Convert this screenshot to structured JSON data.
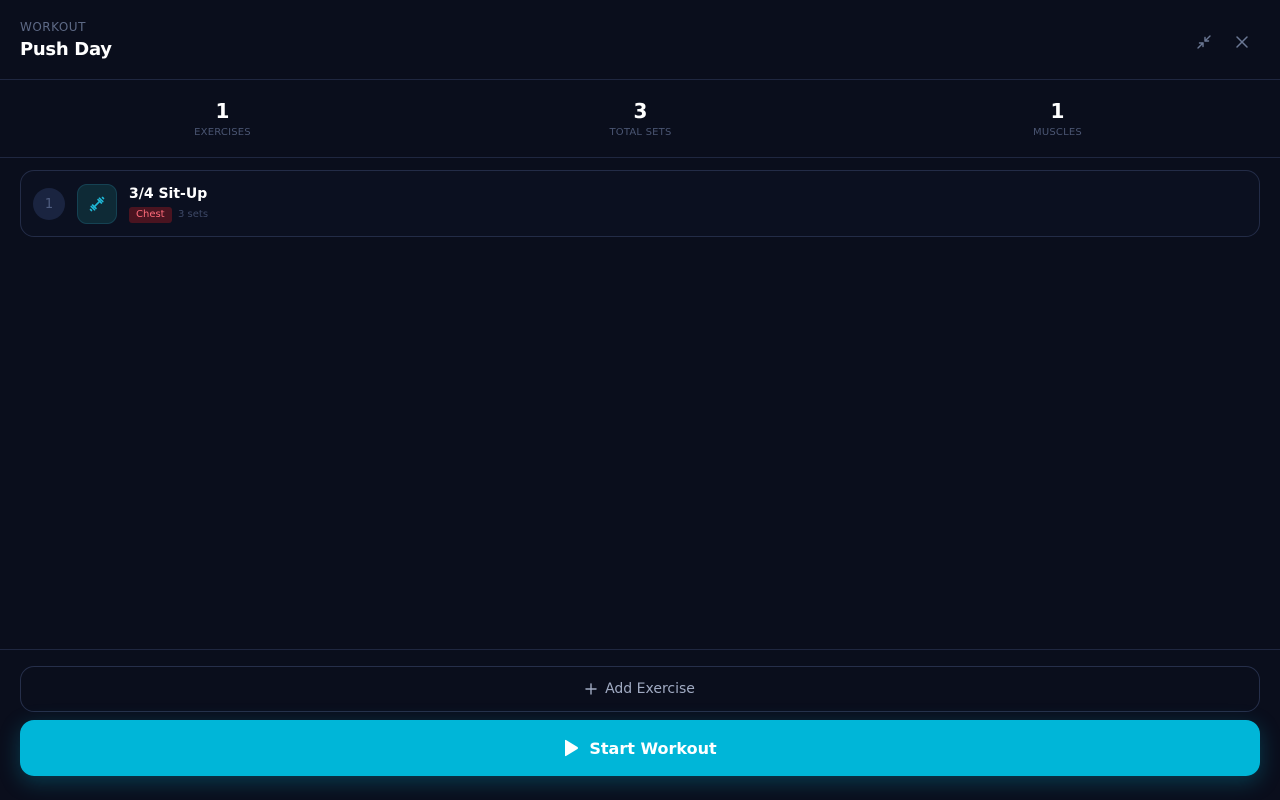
{
  "header": {
    "eyebrow": "WORKOUT",
    "title": "Push Day",
    "minimize_icon": "minimize-icon",
    "close_icon": "close-icon"
  },
  "stats": [
    {
      "value": "1",
      "label": "EXERCISES"
    },
    {
      "value": "3",
      "label": "TOTAL SETS"
    },
    {
      "value": "1",
      "label": "MUSCLES"
    }
  ],
  "exercises": [
    {
      "index": "1",
      "name": "3/4 Sit-Up",
      "muscle": "Chest",
      "sets": "3 sets",
      "icon": "dumbbell-icon"
    }
  ],
  "actions": {
    "add_label": "Add Exercise",
    "add_icon": "plus-icon",
    "start_label": "Start Workout",
    "start_icon": "play-icon"
  },
  "colors": {
    "background": "#0a0e1c",
    "accent": "#00b6d8",
    "tag_bg": "#4a1420",
    "tag_text": "#ff6b7a"
  }
}
